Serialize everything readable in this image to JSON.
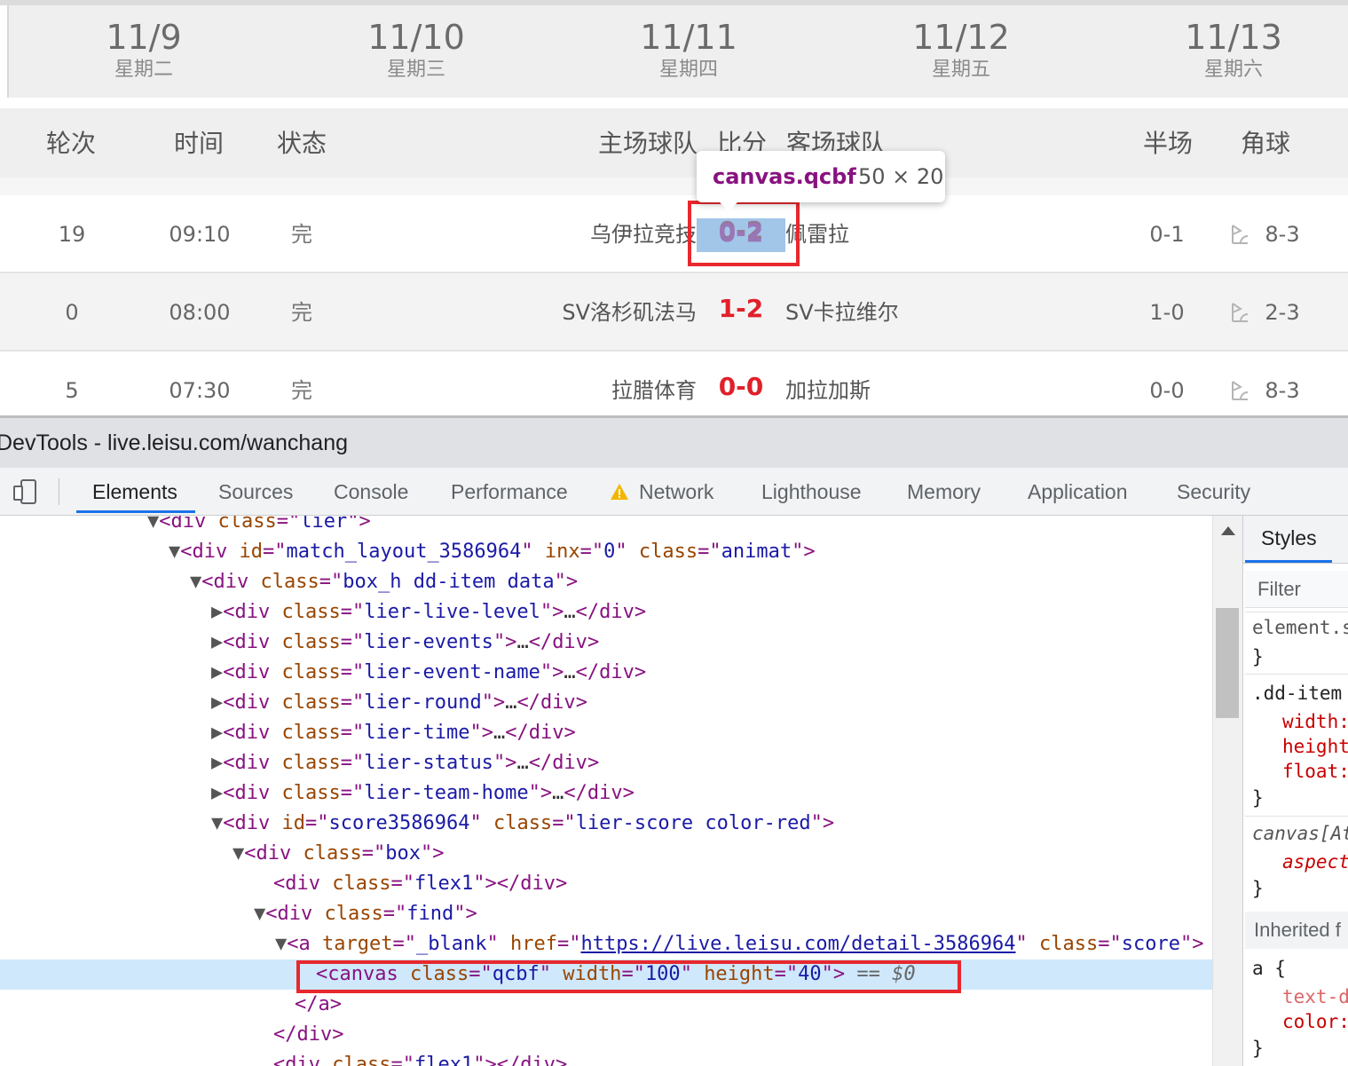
{
  "page": {
    "dates": [
      {
        "md": "11/9",
        "weekday": "星期二"
      },
      {
        "md": "11/10",
        "weekday": "星期三"
      },
      {
        "md": "11/11",
        "weekday": "星期四"
      },
      {
        "md": "11/12",
        "weekday": "星期五"
      },
      {
        "md": "11/13",
        "weekday": "星期六"
      }
    ],
    "headers": {
      "round": "轮次",
      "time": "时间",
      "status": "状态",
      "home": "主场球队",
      "score": "比分",
      "away": "客场球队",
      "half": "半场",
      "corner": "角球"
    },
    "matches": [
      {
        "round": "19",
        "time": "09:10",
        "status": "完",
        "home": "乌伊拉竞技",
        "score": "0-2",
        "away": "佩雷拉",
        "half": "0-1",
        "corner": "8-3"
      },
      {
        "round": "0",
        "time": "08:00",
        "status": "完",
        "home": "SV洛杉矶法马",
        "score": "1-2",
        "away": "SV卡拉维尔",
        "half": "1-0",
        "corner": "2-3"
      },
      {
        "round": "5",
        "time": "07:30",
        "status": "完",
        "home": "拉腊体育",
        "score": "0-0",
        "away": "加拉加斯",
        "half": "0-0",
        "corner": "8-3"
      }
    ],
    "tooltip": {
      "name": "canvas.qcbf",
      "dims": "50 × 20"
    },
    "colors": {
      "score_red": "#e0202a",
      "highlight": "#6fa8dc",
      "annotation_red": "#e8282e"
    }
  },
  "devtools": {
    "title": "DevTools - live.leisu.com/wanchang",
    "tabs": [
      "Elements",
      "Sources",
      "Console",
      "Performance",
      "Network",
      "Lighthouse",
      "Memory",
      "Application",
      "Security"
    ],
    "active_tab": "Elements",
    "network_warning_icon": "warning-triangle-icon",
    "dom": {
      "l0": {
        "tag": "div",
        "attr": "class",
        "val": "lier"
      },
      "l1": {
        "tag": "div",
        "a1": "id",
        "v1": "match_layout_3586964",
        "a2": "inx",
        "v2": "0",
        "a3": "class",
        "v3": "animat"
      },
      "l2": {
        "tag": "div",
        "attr": "class",
        "val": "box_h dd-item data"
      },
      "children": [
        "lier-live-level",
        "lier-events",
        "lier-event-name",
        "lier-round",
        "lier-time",
        "lier-status",
        "lier-team-home"
      ],
      "score_div": {
        "a1": "id",
        "v1": "score3586964",
        "a2": "class",
        "v2": "lier-score color-red"
      },
      "box": "box",
      "flex1": "flex1",
      "find": "find",
      "anchor": {
        "a1": "target",
        "v1": "_blank",
        "a2": "href",
        "v2": "https://live.leisu.com/detail-3586964",
        "a3": "class",
        "v3": "score"
      },
      "canvas": {
        "a1": "class",
        "v1": "qcbf",
        "a2": "width",
        "v2": "100",
        "a3": "height",
        "v3": "40",
        "eq": "== $0"
      },
      "close_a": "a",
      "close_div": "div",
      "tag_div": "div",
      "tag_a": "a",
      "tag_canvas": "canvas",
      "attr_class": "class",
      "ellipsis": "…"
    },
    "styles": {
      "tab": "Styles",
      "filter_placeholder": "Filter",
      "rule1_selector": "element.s",
      "rule2_selector": ".dd-item",
      "rule2_props": [
        "width:",
        "height",
        "float:"
      ],
      "rule3_selector": "canvas[At",
      "rule3_prop": "aspect",
      "inherited": "Inherited f",
      "rule4_selector": "a {",
      "rule4_props": [
        "text-d",
        "color:"
      ],
      "close_brace": "}"
    }
  }
}
